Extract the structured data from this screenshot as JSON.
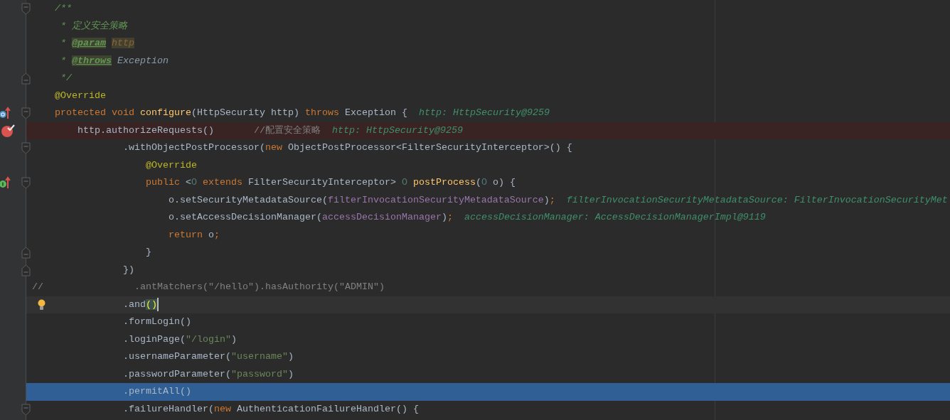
{
  "editor": {
    "lines": [
      {
        "selected": false,
        "fold": {
          "kind": "start"
        },
        "tokens": [
          {
            "text": "    /**",
            "kind": "doc"
          }
        ]
      },
      {
        "selected": false,
        "tokens": [
          {
            "text": "     * 定义安全策略",
            "kind": "doc"
          }
        ]
      },
      {
        "selected": false,
        "tokens": [
          {
            "text": "     * ",
            "kind": "doc"
          },
          {
            "text": "@param",
            "kind": "doc-tag"
          },
          {
            "text": " http",
            "kind": "doc-param"
          }
        ]
      },
      {
        "selected": false,
        "tokens": [
          {
            "text": "     * ",
            "kind": "doc"
          },
          {
            "text": "@throws",
            "kind": "doc-tag"
          },
          {
            "text": " Exception",
            "kind": "doc-ref"
          }
        ]
      },
      {
        "selected": false,
        "fold": {
          "kind": "end"
        },
        "tokens": [
          {
            "text": "     */",
            "kind": "doc"
          }
        ]
      },
      {
        "selected": false,
        "tokens": [
          {
            "text": "    @Override",
            "kind": "annotation"
          }
        ]
      },
      {
        "selected": false,
        "fold": {
          "kind": "start"
        },
        "gutter_icon": {
          "kind": "overrides"
        },
        "tokens": [
          {
            "text": "    protected void ",
            "kind": "keyword"
          },
          {
            "text": "configure",
            "kind": "method"
          },
          {
            "text": "(HttpSecurity http) ",
            "kind": "plain"
          },
          {
            "text": "throws",
            "kind": "keyword"
          },
          {
            "text": " Exception {",
            "kind": "plain"
          }
        ],
        "hint": "http: HttpSecurity@9259"
      },
      {
        "selected": false,
        "breakpoint": true,
        "gutter_icon": {
          "kind": "breakpoint"
        },
        "tokens": [
          {
            "text": "        http.authorizeRequests()       ",
            "kind": "plain"
          },
          {
            "text": "//配置安全策略",
            "kind": "comment"
          }
        ],
        "hint": "http: HttpSecurity@9259"
      },
      {
        "selected": false,
        "fold": {
          "kind": "start"
        },
        "tokens": [
          {
            "text": "                .withObjectPostProcessor(",
            "kind": "plain"
          },
          {
            "text": "new",
            "kind": "keyword"
          },
          {
            "text": " ObjectPostProcessor<FilterSecurityInterceptor>() {",
            "kind": "plain"
          }
        ]
      },
      {
        "selected": false,
        "tokens": [
          {
            "text": "                    @Override",
            "kind": "annotation"
          }
        ]
      },
      {
        "selected": false,
        "fold": {
          "kind": "start"
        },
        "gutter_icon": {
          "kind": "implements"
        },
        "tokens": [
          {
            "text": "                    public",
            "kind": "keyword"
          },
          {
            "text": " <",
            "kind": "plain"
          },
          {
            "text": "O",
            "kind": "type-param"
          },
          {
            "text": " extends",
            "kind": "keyword"
          },
          {
            "text": " FilterSecurityInterceptor> ",
            "kind": "plain"
          },
          {
            "text": "O",
            "kind": "type-param"
          },
          {
            "text": " postProcess",
            "kind": "method"
          },
          {
            "text": "(",
            "kind": "plain"
          },
          {
            "text": "O",
            "kind": "type-param"
          },
          {
            "text": " o) {",
            "kind": "plain"
          }
        ]
      },
      {
        "selected": false,
        "tokens": [
          {
            "text": "                        o.setSecurityMetadataSource(",
            "kind": "plain"
          },
          {
            "text": "filterInvocationSecurityMetadataSource",
            "kind": "field"
          },
          {
            "text": ")",
            "kind": "plain"
          },
          {
            "text": ";",
            "kind": "keyword"
          }
        ],
        "hint": "filterInvocationSecurityMetadataSource: FilterInvocationSecurityMet"
      },
      {
        "selected": false,
        "tokens": [
          {
            "text": "                        o.setAccessDecisionManager(",
            "kind": "plain"
          },
          {
            "text": "accessDecisionManager",
            "kind": "field"
          },
          {
            "text": ")",
            "kind": "plain"
          },
          {
            "text": ";",
            "kind": "keyword"
          }
        ],
        "hint": "accessDecisionManager: AccessDecisionManagerImpl@9119"
      },
      {
        "selected": false,
        "tokens": [
          {
            "text": "                        return",
            "kind": "keyword"
          },
          {
            "text": " o",
            "kind": "plain"
          },
          {
            "text": ";",
            "kind": "keyword"
          }
        ]
      },
      {
        "selected": false,
        "fold": {
          "kind": "end"
        },
        "tokens": [
          {
            "text": "                    }",
            "kind": "plain"
          }
        ]
      },
      {
        "selected": false,
        "fold": {
          "kind": "end"
        },
        "tokens": [
          {
            "text": "                })",
            "kind": "plain"
          }
        ]
      },
      {
        "selected": false,
        "tokens": [
          {
            "text": "//                .antMatchers(\"/hello\").hasAuthority(\"ADMIN\")",
            "kind": "comment"
          }
        ]
      },
      {
        "selected": false,
        "caret": true,
        "gutter_icon": {
          "kind": "bulb"
        },
        "tokens": [
          {
            "text": "                .and",
            "kind": "plain"
          },
          {
            "text": "()",
            "kind": "brace-match"
          }
        ]
      },
      {
        "selected": false,
        "tokens": [
          {
            "text": "                .formLogin()",
            "kind": "plain"
          }
        ]
      },
      {
        "selected": false,
        "tokens": [
          {
            "text": "                .loginPage(",
            "kind": "plain"
          },
          {
            "text": "\"/login\"",
            "kind": "string"
          },
          {
            "text": ")",
            "kind": "plain"
          }
        ]
      },
      {
        "selected": false,
        "tokens": [
          {
            "text": "                .usernameParameter(",
            "kind": "plain"
          },
          {
            "text": "\"username\"",
            "kind": "string"
          },
          {
            "text": ")",
            "kind": "plain"
          }
        ]
      },
      {
        "selected": false,
        "tokens": [
          {
            "text": "                .passwordParameter(",
            "kind": "plain"
          },
          {
            "text": "\"password\"",
            "kind": "string"
          },
          {
            "text": ")",
            "kind": "plain"
          }
        ]
      },
      {
        "selected": true,
        "tokens": [
          {
            "text": "                .permitAll()",
            "kind": "plain"
          }
        ]
      },
      {
        "selected": false,
        "fold": {
          "kind": "start"
        },
        "tokens": [
          {
            "text": "                .failureHandler(",
            "kind": "plain"
          },
          {
            "text": "new",
            "kind": "keyword"
          },
          {
            "text": " AuthenticationFailureHandler() {",
            "kind": "plain"
          }
        ]
      }
    ]
  }
}
